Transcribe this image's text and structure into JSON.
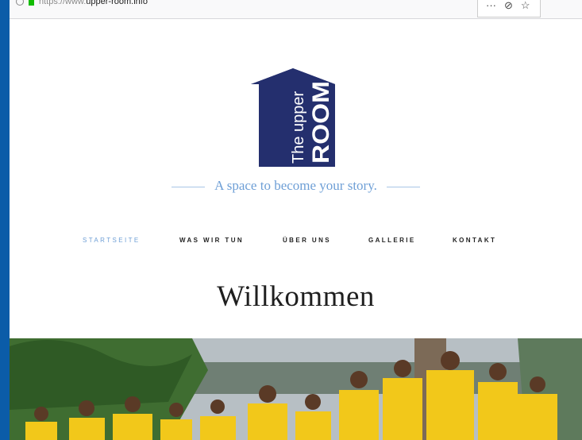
{
  "browser": {
    "url_prefix": "https://www.",
    "url_domain": "upper-room.info",
    "menu_dots": "···"
  },
  "logo": {
    "line1": "The upper",
    "line2": "ROOM",
    "color": "#242f6e"
  },
  "tagline": "A space to become your story.",
  "nav": {
    "items": [
      {
        "label": "STARTSEITE",
        "active": true
      },
      {
        "label": "WAS WIR TUN",
        "active": false
      },
      {
        "label": "ÜBER UNS",
        "active": false
      },
      {
        "label": "GALLERIE",
        "active": false
      },
      {
        "label": "KONTAKT",
        "active": false
      }
    ]
  },
  "headline": "Willkommen",
  "hero_image": {
    "description_icon": "group-photo-image"
  },
  "colors": {
    "accent": "#6e9fd6",
    "logo": "#242f6e",
    "desktop": "#0b5ca8"
  }
}
